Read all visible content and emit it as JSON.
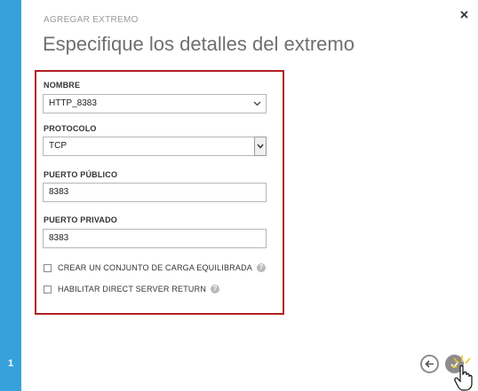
{
  "dialog": {
    "subtitle": "AGREGAR EXTREMO",
    "title": "Especifique los detalles del extremo",
    "step": "1"
  },
  "form": {
    "name": {
      "label": "NOMBRE",
      "value": "HTTP_8383"
    },
    "protocol": {
      "label": "PROTOCOLO",
      "value": "TCP"
    },
    "public_port": {
      "label": "PUERTO PÚBLICO",
      "value": "8383"
    },
    "private_port": {
      "label": "PUERTO PRIVADO",
      "value": "8383"
    },
    "load_balanced": {
      "label": "CREAR UN CONJUNTO DE CARGA EQUILIBRADA",
      "checked": false
    },
    "direct_server_return": {
      "label": "HABILITAR DIRECT SERVER RETURN",
      "checked": false
    },
    "help_glyph": "?"
  },
  "icons": {
    "close": "close-icon",
    "back": "arrow-left-icon",
    "finish": "checkmark-icon"
  },
  "colors": {
    "accent": "#36a2dc",
    "highlight": "#b21f24"
  }
}
